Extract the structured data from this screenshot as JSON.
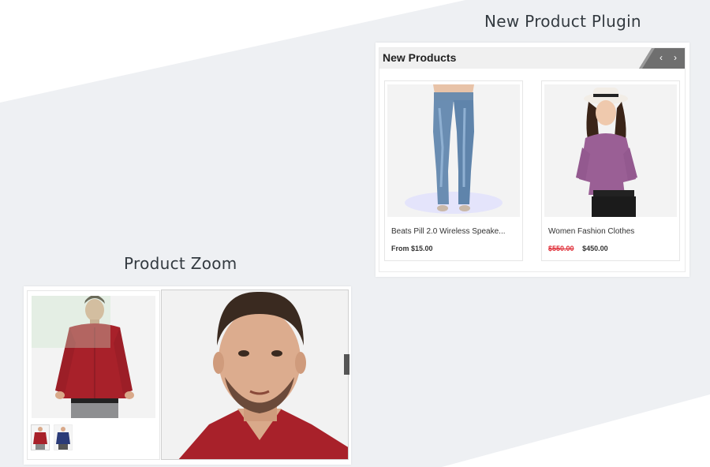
{
  "sections": {
    "new_product_plugin_title": "New Product Plugin",
    "product_zoom_title": "Product Zoom"
  },
  "new_products": {
    "header": "New Products",
    "nav": {
      "prev": "‹",
      "next": "›"
    },
    "items": [
      {
        "name": "Beats Pill 2.0 Wireless Speake...",
        "price_prefix": "From",
        "price": "$15.00",
        "old_price": "",
        "image_icon": "jeans-product-image"
      },
      {
        "name": "Women Fashion Clothes",
        "price_prefix": "",
        "price": "$450.00",
        "old_price": "$550.00",
        "image_icon": "women-blouse-product-image"
      }
    ]
  },
  "colors": {
    "background_band": "#eef0f3",
    "old_price": "#e0303a",
    "header_bg": "#f0f0f0",
    "nav_bg": "#6f6f6f"
  }
}
